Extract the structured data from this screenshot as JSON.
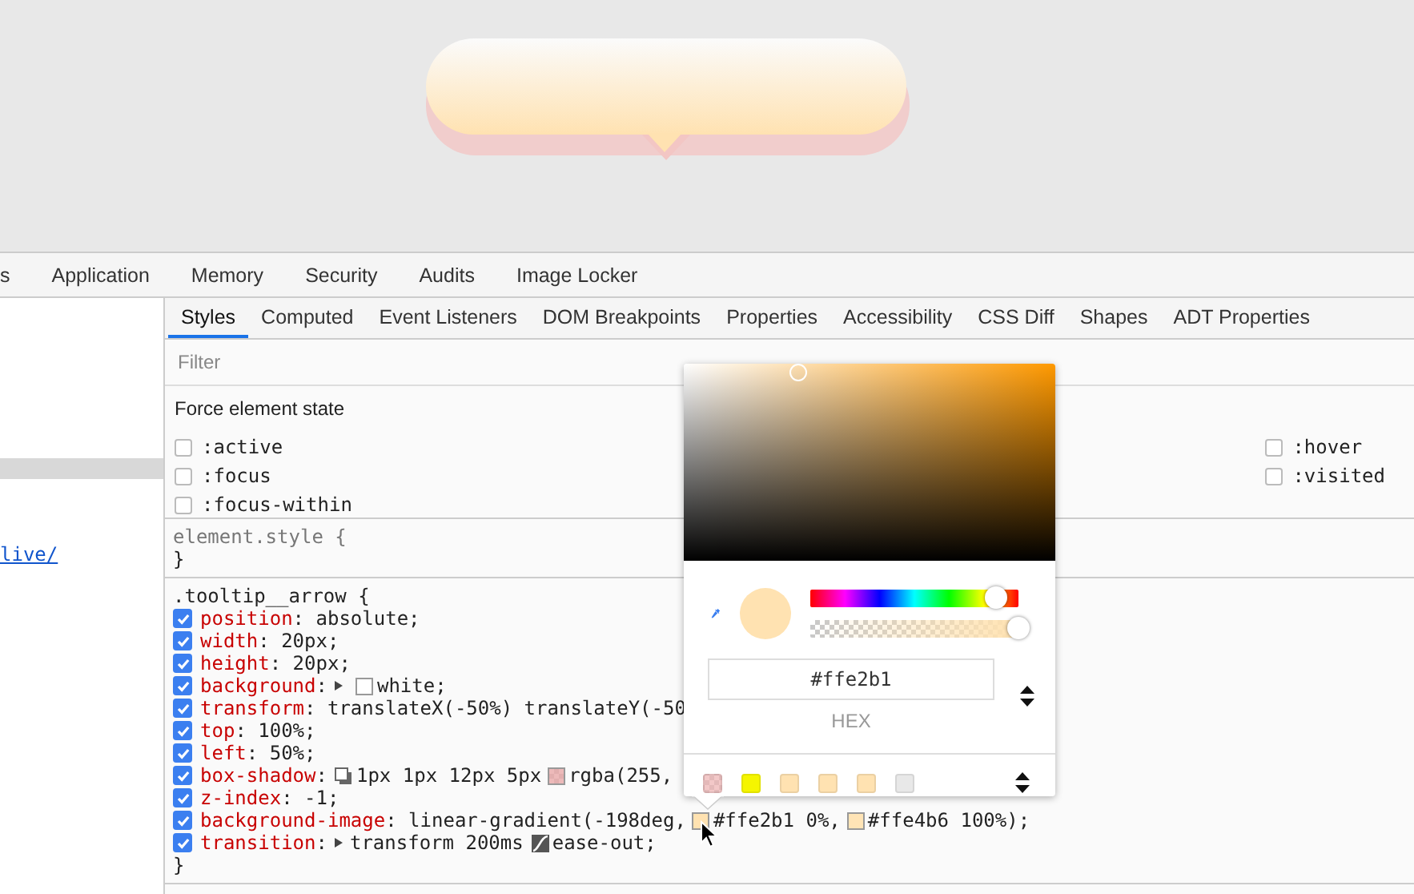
{
  "main_tabs": [
    {
      "label": "s",
      "selected": false
    },
    {
      "label": "Application",
      "selected": false
    },
    {
      "label": "Memory",
      "selected": false
    },
    {
      "label": "Security",
      "selected": false
    },
    {
      "label": "Audits",
      "selected": false
    },
    {
      "label": "Image Locker",
      "selected": false
    }
  ],
  "elements_pane": {
    "link": "live/"
  },
  "style_tabs": [
    {
      "label": "Styles",
      "selected": true
    },
    {
      "label": "Computed",
      "selected": false
    },
    {
      "label": "Event Listeners",
      "selected": false
    },
    {
      "label": "DOM Breakpoints",
      "selected": false
    },
    {
      "label": "Properties",
      "selected": false
    },
    {
      "label": "Accessibility",
      "selected": false
    },
    {
      "label": "CSS Diff",
      "selected": false
    },
    {
      "label": "Shapes",
      "selected": false
    },
    {
      "label": "ADT Properties",
      "selected": false
    }
  ],
  "filter": {
    "placeholder": "Filter"
  },
  "force_state": {
    "title": "Force element state",
    "left": [
      {
        "label": ":active",
        "checked": false
      },
      {
        "label": ":focus",
        "checked": false
      },
      {
        "label": ":focus-within",
        "checked": false
      }
    ],
    "right": [
      {
        "label": ":hover",
        "checked": false
      },
      {
        "label": ":visited",
        "checked": false
      }
    ]
  },
  "element_style": {
    "selector": "element.style {",
    "close": "}"
  },
  "rule": {
    "selector": ".tooltip__arrow {",
    "close": "}",
    "declarations": [
      {
        "enabled": true,
        "name": "position",
        "value": [
          {
            "kind": "text",
            "text": ": absolute;"
          }
        ]
      },
      {
        "enabled": true,
        "name": "width",
        "value": [
          {
            "kind": "text",
            "text": ": 20px;"
          }
        ]
      },
      {
        "enabled": true,
        "name": "height",
        "value": [
          {
            "kind": "text",
            "text": ": 20px;"
          }
        ]
      },
      {
        "enabled": true,
        "name": "background",
        "value": [
          {
            "kind": "text",
            "text": ":"
          },
          {
            "kind": "expand"
          },
          {
            "kind": "swatch",
            "color": "#ffffff"
          },
          {
            "kind": "text",
            "text": "white;"
          }
        ]
      },
      {
        "enabled": true,
        "name": "transform",
        "value": [
          {
            "kind": "text",
            "text": ": translateX(-50%) translateY(-50"
          }
        ]
      },
      {
        "enabled": true,
        "name": "top",
        "value": [
          {
            "kind": "text",
            "text": ": 100%;"
          }
        ]
      },
      {
        "enabled": true,
        "name": "left",
        "value": [
          {
            "kind": "text",
            "text": ": 50%;"
          }
        ]
      },
      {
        "enabled": true,
        "name": "box-shadow",
        "value": [
          {
            "kind": "text",
            "text": ":"
          },
          {
            "kind": "shadow"
          },
          {
            "kind": "text",
            "text": "1px 1px 12px 5px"
          },
          {
            "kind": "translucent-swatch",
            "color": "#e8a8a8"
          },
          {
            "kind": "text",
            "text": "rgba(255,"
          }
        ]
      },
      {
        "enabled": true,
        "name": "z-index",
        "value": [
          {
            "kind": "text",
            "text": ": -1;"
          }
        ]
      },
      {
        "enabled": true,
        "name": "background-image",
        "value": [
          {
            "kind": "text",
            "text": ": linear-gradient(-198deg,"
          },
          {
            "kind": "swatch",
            "color": "#ffe2b1"
          },
          {
            "kind": "text",
            "text": "#ffe2b1 0%,"
          },
          {
            "kind": "swatch",
            "color": "#ffe4b6"
          },
          {
            "kind": "text",
            "text": "#ffe4b6 100%);"
          }
        ]
      },
      {
        "enabled": true,
        "name": "transition",
        "value": [
          {
            "kind": "text",
            "text": ":"
          },
          {
            "kind": "expand"
          },
          {
            "kind": "text",
            "text": "transform 200ms"
          },
          {
            "kind": "easing"
          },
          {
            "kind": "text",
            "text": "ease-out;"
          }
        ]
      }
    ]
  },
  "color_picker": {
    "color": "#ffe2b1",
    "hue": {
      "level": 0.89
    },
    "alpha": {
      "level": 1
    },
    "hex": "#ffe2b1",
    "format": "HEX",
    "palette": [
      {
        "kind": "translucent",
        "color": "#eeb4b4"
      },
      {
        "kind": "solid",
        "color": "#f5f500"
      },
      {
        "kind": "solid",
        "color": "#ffe2b1"
      },
      {
        "kind": "solid",
        "color": "#ffe2b1"
      },
      {
        "kind": "solid",
        "color": "#ffe2b1"
      },
      {
        "kind": "solid",
        "color": "#e8e8e8"
      }
    ]
  }
}
